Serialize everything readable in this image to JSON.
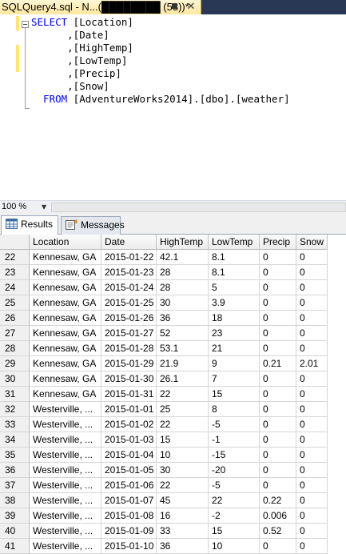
{
  "tab": {
    "title": "SQLQuery4.sql - N...(████████ (53))*",
    "pin_glyph": "■",
    "close_glyph": "✕"
  },
  "editor": {
    "lines": [
      {
        "kw": "SELECT",
        "rest": " [Location]"
      },
      {
        "kw": "",
        "rest": "      ,[Date]"
      },
      {
        "kw": "",
        "rest": "      ,[HighTemp]"
      },
      {
        "kw": "",
        "rest": "      ,[LowTemp]"
      },
      {
        "kw": "",
        "rest": "      ,[Precip]"
      },
      {
        "kw": "",
        "rest": "      ,[Snow]"
      },
      {
        "kw": "  FROM",
        "rest": " [AdventureWorks2014].[dbo].[weather]"
      }
    ]
  },
  "zoom": {
    "value": "100 %"
  },
  "results_tabs": {
    "results": "Results",
    "messages": "Messages"
  },
  "grid": {
    "columns": [
      "",
      "Location",
      "Date",
      "HighTemp",
      "LowTemp",
      "Precip",
      "Snow"
    ],
    "rows": [
      [
        "22",
        "Kennesaw, GA",
        "2015-01-22",
        "42.1",
        "8.1",
        "0",
        "0"
      ],
      [
        "23",
        "Kennesaw, GA",
        "2015-01-23",
        "28",
        "8.1",
        "0",
        "0"
      ],
      [
        "24",
        "Kennesaw, GA",
        "2015-01-24",
        "28",
        "5",
        "0",
        "0"
      ],
      [
        "25",
        "Kennesaw, GA",
        "2015-01-25",
        "30",
        "3.9",
        "0",
        "0"
      ],
      [
        "26",
        "Kennesaw, GA",
        "2015-01-26",
        "36",
        "18",
        "0",
        "0"
      ],
      [
        "27",
        "Kennesaw, GA",
        "2015-01-27",
        "52",
        "23",
        "0",
        "0"
      ],
      [
        "28",
        "Kennesaw, GA",
        "2015-01-28",
        "53.1",
        "21",
        "0",
        "0"
      ],
      [
        "29",
        "Kennesaw, GA",
        "2015-01-29",
        "21.9",
        "9",
        "0.21",
        "2.01"
      ],
      [
        "30",
        "Kennesaw, GA",
        "2015-01-30",
        "26.1",
        "7",
        "0",
        "0"
      ],
      [
        "31",
        "Kennesaw, GA",
        "2015-01-31",
        "22",
        "15",
        "0",
        "0"
      ],
      [
        "32",
        "Westerville, ...",
        "2015-01-01",
        "25",
        "8",
        "0",
        "0"
      ],
      [
        "33",
        "Westerville, ...",
        "2015-01-02",
        "22",
        "-5",
        "0",
        "0"
      ],
      [
        "34",
        "Westerville, ...",
        "2015-01-03",
        "15",
        "-1",
        "0",
        "0"
      ],
      [
        "35",
        "Westerville, ...",
        "2015-01-04",
        "10",
        "-15",
        "0",
        "0"
      ],
      [
        "36",
        "Westerville, ...",
        "2015-01-05",
        "30",
        "-20",
        "0",
        "0"
      ],
      [
        "37",
        "Westerville, ...",
        "2015-01-06",
        "22",
        "-5",
        "0",
        "0"
      ],
      [
        "38",
        "Westerville, ...",
        "2015-01-07",
        "45",
        "22",
        "0.22",
        "0"
      ],
      [
        "39",
        "Westerville, ...",
        "2015-01-08",
        "16",
        "-2",
        "0.006",
        "0"
      ],
      [
        "40",
        "Westerville, ...",
        "2015-01-09",
        "33",
        "15",
        "0.52",
        "0"
      ],
      [
        "41",
        "Westerville, ...",
        "2015-01-10",
        "36",
        "10",
        "0",
        "0"
      ]
    ]
  }
}
